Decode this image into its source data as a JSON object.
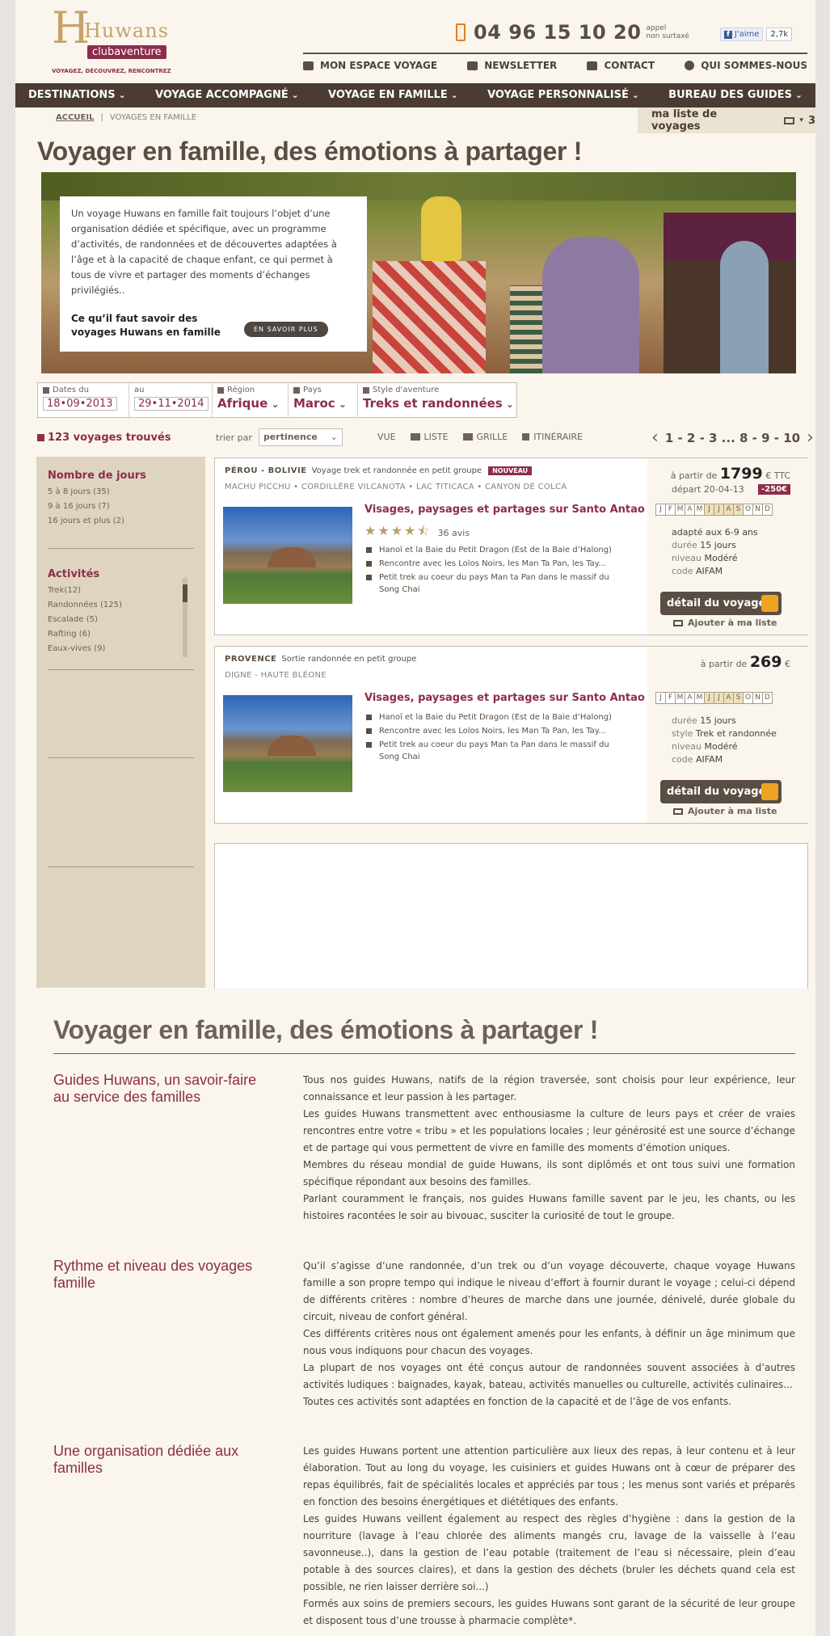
{
  "header": {
    "logo": {
      "brand": "Huwans",
      "sub": "clubaventure",
      "tagline": "VOYAGEZ, DÉCOUVREZ, RENCONTREZ"
    },
    "phone": "04 96 15 10 20",
    "phone_note_1": "appel",
    "phone_note_2": "non surtaxé",
    "fb_like": "J'aime",
    "fb_count": "2,7k",
    "links": [
      "MON ESPACE VOYAGE",
      "NEWSLETTER",
      "CONTACT",
      "QUI SOMMES-NOUS"
    ]
  },
  "nav": [
    "DESTINATIONS",
    "VOYAGE ACCOMPAGNÉ",
    "VOYAGE EN FAMILLE",
    "VOYAGE PERSONNALISÉ",
    "BUREAU DES GUIDES"
  ],
  "breadcrumb": {
    "home": "ACCUEIL",
    "sep": "|",
    "current": "VOYAGES EN FAMILLE"
  },
  "my_list": {
    "label": "ma liste de voyages",
    "count": "3"
  },
  "page_title": "Voyager en famille,  des émotions à partager !",
  "hero": {
    "text": "Un voyage Huwans en famille fait toujours l’objet d’une organisation dédiée et spécifique, avec un programme d’activités,  de randonnées et de découvertes adaptées à l’âge et à la capacité de chaque enfant, ce qui permet à tous de vivre et partager des moments d’échanges privilégiés..",
    "bold": "Ce qu’il faut savoir des voyages Huwans en famille",
    "button": "EN SAVOIR PLUS"
  },
  "filters": {
    "dates_label": "Dates du",
    "date_from": "18•09•2013",
    "au_label": "au",
    "date_to": "29•11•2014",
    "region_label": "Région",
    "region": "Afrique",
    "pays_label": "Pays",
    "pays": "Maroc",
    "style_label": "Style d'aventure",
    "style": "Treks et randonnées"
  },
  "results": {
    "found": "123 voyages trouvés",
    "sort_label": "trier par",
    "sort_value": "pertinence",
    "view_label": "vue",
    "views": [
      "LISTE",
      "GRILLE",
      "ITINÉRAIRE"
    ],
    "pagination": "1 - 2 - 3 ... 8 - 9 - 10"
  },
  "sidebar": {
    "days_title": "Nombre de jours",
    "days": [
      "5 à 8 jours (35)",
      "9 à 16 jours (7)",
      "16 jours et plus (2)"
    ],
    "act_title": "Activités",
    "activities": [
      "Trek(12)",
      "Randonnées (125)",
      "Escalade (5)",
      "Rafting (6)",
      "Eaux-vives (9)"
    ]
  },
  "months": [
    "J",
    "F",
    "M",
    "A",
    "M",
    "J",
    "J",
    "A",
    "S",
    "O",
    "N",
    "D"
  ],
  "cards": [
    {
      "place": "PÉROU - BOLIVIE",
      "type": "Voyage trek et randonnée en petit groupe",
      "badge": "NOUVEAU",
      "route": "MACHU PICCHU • CORDILLÈRE VILCANOTA • LAC TITICACA • CANYON DE COLCA",
      "title": "Visages, paysages et partages sur Santo Antao",
      "stars": "★★★★⯪",
      "reviews": "36 avis",
      "bullets": [
        "Hanoï et la Baie du Petit Dragon (Est de la Baie d’Halong)",
        "Rencontre avec les Lolos Noirs, les Man Ta Pan, les Tay...",
        "Petit trek au coeur du pays Man ta Pan dans le massif du Song Chai"
      ],
      "from": "à partir de",
      "price": "1799",
      "currency": "€ TTC",
      "departure": "départ 20-04-13",
      "discount": "-250€",
      "info1_k": "adapté aux 6-9 ans",
      "info1_v": "",
      "info2_k": "durée",
      "info2_v": "15 jours",
      "info3_k": "niveau",
      "info3_v": "Modéré",
      "info4_k": "code",
      "info4_v": "AIFAM",
      "detail": "détail du voyage",
      "add": "Ajouter à ma liste"
    },
    {
      "place": "PROVENCE",
      "type": "Sortie randonnée en petit groupe",
      "route": "DIGNE - HAUTE BLÉONE",
      "title": "Visages, paysages et partages sur Santo Antao",
      "bullets": [
        "Hanoï et la Baie du Petit Dragon (Est de la Baie d’Halong)",
        "Rencontre avec les Lolos Noirs, les Man Ta Pan, les Tay...",
        "Petit trek au coeur du pays Man ta Pan dans le massif du Song Chai"
      ],
      "from": "à partir de",
      "price": "269",
      "currency": "€",
      "info1_k": "durée",
      "info1_v": "15 jours",
      "info2_k": "style",
      "info2_v": "Trek et randonnée",
      "info3_k": "niveau",
      "info3_v": "Modéré",
      "info4_k": "code",
      "info4_v": "AIFAM",
      "detail": "détail du voyage",
      "add": "Ajouter à ma liste"
    }
  ],
  "article": {
    "title": "Voyager en famille,  des émotions à partager !",
    "sections": [
      {
        "heading": "Guides Huwans, un savoir-faire au service des familles",
        "text": "Tous nos guides Huwans, natifs de la région traversée, sont choisis pour leur expérience,  leur connaissance et leur passion à les partager.\nLes guides Huwans transmettent avec enthousiasme la culture de leurs pays et créer de vraies rencontres entre votre « tribu » et les populations locales ; leur générosité est une source d’échange et de partage qui  vous permettent de vivre en famille des moments d’émotion uniques.\nMembres du réseau mondial de guide Huwans, ils sont  diplômés et ont tous suivi une formation spécifique répondant aux besoins des familles.\nParlant couramment le français, nos guides Huwans famille savent par le jeu, les chants, ou les histoires racontées le soir au bivouac,  susciter la curiosité de tout le groupe."
      },
      {
        "heading": "Rythme et niveau des voyages famille",
        "text": "Qu’il s’agisse d’une randonnée, d’un trek ou d’un voyage découverte, chaque voyage Huwans famille a son propre tempo qui indique le niveau d’effort à fournir durant le voyage ; celui-ci dépend de différents critères : nombre d’heures de marche dans une journée, dénivelé, durée globale du circuit, niveau de confort général.\nCes différents critères nous ont également amenés pour les enfants, à définir un âge minimum que nous vous indiquons pour chacun des voyages.\nLa plupart de nos voyages ont été conçus autour de randonnées souvent associées à d’autres activités ludiques : baignades, kayak, bateau, activités manuelles ou culturelle, activités culinaires...\nToutes ces activités sont adaptées en fonction de la capacité et de l’âge de vos enfants."
      },
      {
        "heading": "Une organisation dédiée aux familles",
        "text": "Les guides Huwans portent une attention particulière aux lieux des repas, à leur contenu et à leur élaboration. Tout au long du voyage, les cuisiniers et guides Huwans ont à cœur de préparer des repas équilibrés, fait de spécialités locales  et appréciés par tous ; les menus sont variés et  préparés en fonction des besoins énergétiques et diététiques des enfants.\nLes guides Huwans veillent également au respect des règles d’hygiène : dans la gestion de la nourriture (lavage à l’eau chlorée des aliments mangés cru, lavage de la vaisselle à l’eau savonneuse..), dans la gestion de l’eau potable (traitement de l’eau si nécessaire,  plein d’eau potable à des sources claires), et dans la gestion des déchets (bruler les déchets quand cela est possible, ne rien laisser derrière soi...)\nFormés aux soins de premiers secours, les guides Huwans sont garant de la sécurité de leur groupe et disposent tous d’une trousse à pharmacie complète*."
      }
    ]
  }
}
